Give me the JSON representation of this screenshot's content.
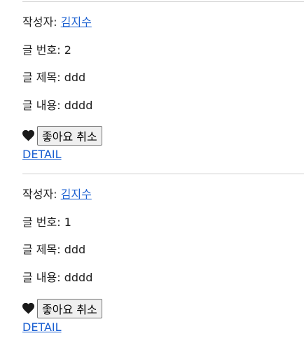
{
  "posts": [
    {
      "author_label": "작성자: ",
      "author_name": "김지수",
      "number_line": "글 번호: 2",
      "title_line": "글 제목: ddd",
      "content_line": "글 내용: dddd",
      "like_icon": "heart-filled-icon",
      "unlike_button_label": "좋아요 취소",
      "detail_link": "DETAIL"
    },
    {
      "author_label": "작성자: ",
      "author_name": "김지수",
      "number_line": "글 번호: 1",
      "title_line": "글 제목: ddd",
      "content_line": "글 내용: dddd",
      "like_icon": "heart-filled-icon",
      "unlike_button_label": "좋아요 취소",
      "detail_link": "DETAIL"
    }
  ]
}
